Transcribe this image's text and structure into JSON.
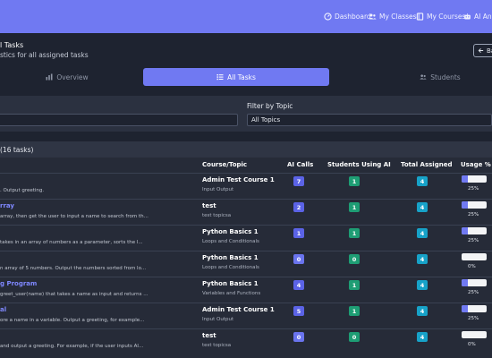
{
  "nav": {
    "dashboard": "Dashboard",
    "my_classes": "My Classes",
    "my_courses": "My Courses",
    "ai_analytics": "AI Ana"
  },
  "header": {
    "title": "l Tasks",
    "subtitle": "stics for all assigned tasks",
    "back": "Ba"
  },
  "tabs": [
    {
      "label": "Overview",
      "icon": "chart-bar-icon"
    },
    {
      "label": "All Tasks",
      "icon": "list-icon"
    },
    {
      "label": "Students",
      "icon": "users-icon"
    }
  ],
  "filters": {
    "topic_label": "Filter by Topic",
    "topic_value": "All Topics",
    "search_value": ""
  },
  "table": {
    "heading": "(16 tasks)",
    "columns": [
      "Course/Topic",
      "AI Calls",
      "Students Using AI",
      "Total Assigned",
      "Usage %"
    ],
    "rows": [
      {
        "title": "",
        "desc": ". Output greeting.",
        "course": "Admin Test Course 1",
        "topic": "Input Output",
        "ai_calls": 7,
        "students_ai": 1,
        "assigned": 4,
        "usage": 0.25,
        "usage_label": "25%"
      },
      {
        "title": "rray",
        "desc": "array, then get the user to input a name to search from th...",
        "course": "test",
        "topic": "test topicsa",
        "ai_calls": 2,
        "students_ai": 1,
        "assigned": 4,
        "usage": 0.25,
        "usage_label": "25%"
      },
      {
        "title": "",
        "desc": "takes in an array of numbers as a parameter, sorts the l...",
        "course": "Python Basics 1",
        "topic": "Loops and Conditionals",
        "ai_calls": 1,
        "students_ai": 1,
        "assigned": 4,
        "usage": 0.25,
        "usage_label": "25%"
      },
      {
        "title": "",
        "desc": "n array of 5 numbers. Output the numbers sorted from lo...",
        "course": "Python Basics 1",
        "topic": "Loops and Conditionals",
        "ai_calls": 0,
        "students_ai": 0,
        "assigned": 4,
        "usage": 0,
        "usage_label": "0%"
      },
      {
        "title": "g Program",
        "desc": "greet_user(name) that takes a name as input and returns ...",
        "course": "Python Basics 1",
        "topic": "Variables and Functions",
        "ai_calls": 4,
        "students_ai": 1,
        "assigned": 4,
        "usage": 0.25,
        "usage_label": "25%"
      },
      {
        "title": "al",
        "desc": "ore a name in a variable. Output a greeting, for example...",
        "course": "Admin Test Course 1",
        "topic": "Input Output",
        "ai_calls": 5,
        "students_ai": 1,
        "assigned": 4,
        "usage": 0.25,
        "usage_label": "25%"
      },
      {
        "title": "",
        "desc": "and output a greeting. For example, if the user inputs Al...",
        "course": "test",
        "topic": "test topicsa",
        "ai_calls": 0,
        "students_ai": 0,
        "assigned": 4,
        "usage": 0,
        "usage_label": "0%"
      }
    ]
  },
  "colors": {
    "accent": "#7079f2",
    "ai_calls_badge": "#5b63e6",
    "ai_calls_zero_badge": "#6a74ee",
    "students_badge": "#1e9d74",
    "assigned_badge": "#17a2c8"
  }
}
